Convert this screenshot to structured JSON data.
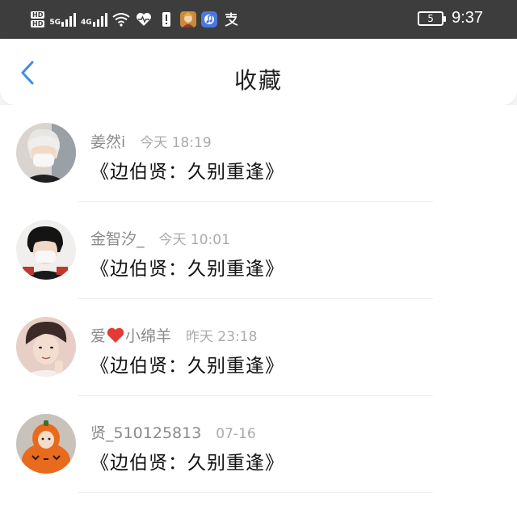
{
  "status": {
    "net1": "5G",
    "net2": "4G",
    "hd1": "HD",
    "hd2": "HD",
    "battery": "5",
    "time": "9:37"
  },
  "header": {
    "title": "收藏"
  },
  "favorites": [
    {
      "user_prefix": "姜然i",
      "user_suffix": "",
      "time": "今天 18:19",
      "content": "《边伯贤：久别重逢》"
    },
    {
      "user_prefix": "金智汐_",
      "user_suffix": "",
      "time": "今天 10:01",
      "content": "《边伯贤：久别重逢》"
    },
    {
      "user_prefix": "爱",
      "user_suffix": "小绵羊",
      "time": "昨天 23:18",
      "content": "《边伯贤：久别重逢》"
    },
    {
      "user_prefix": "贤_510125813",
      "user_suffix": "",
      "time": "07-16",
      "content": "《边伯贤：久别重逢》"
    }
  ],
  "colors": {
    "accent": "#3a8ee6",
    "heart": "#e53935"
  }
}
